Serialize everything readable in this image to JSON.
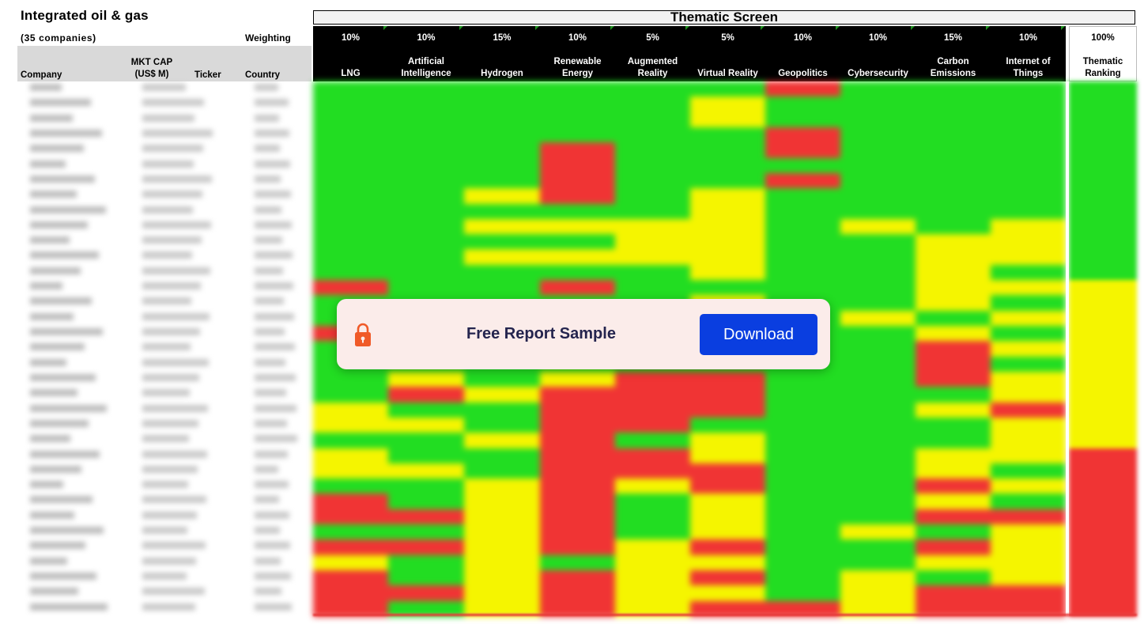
{
  "sheet": {
    "title": "Integrated oil & gas",
    "subtitle": "(35 companies)",
    "weighting_label": "Weighting",
    "thematic_screen_label": "Thematic Screen"
  },
  "columns": {
    "company": "Company",
    "mkt_cap_line1": "MKT CAP",
    "mkt_cap_line2": "(US$ M)",
    "ticker": "Ticker",
    "country": "Country"
  },
  "themes": [
    {
      "weight": "10%",
      "name_line1": "",
      "name_line2": "LNG"
    },
    {
      "weight": "10%",
      "name_line1": "Artificial",
      "name_line2": "Intelligence"
    },
    {
      "weight": "15%",
      "name_line1": "",
      "name_line2": "Hydrogen"
    },
    {
      "weight": "10%",
      "name_line1": "Renewable",
      "name_line2": "Energy"
    },
    {
      "weight": "5%",
      "name_line1": "Augmented",
      "name_line2": "Reality"
    },
    {
      "weight": "5%",
      "name_line1": "",
      "name_line2": "Virtual Reality"
    },
    {
      "weight": "10%",
      "name_line1": "",
      "name_line2": "Geopolitics"
    },
    {
      "weight": "10%",
      "name_line1": "",
      "name_line2": "Cybersecurity"
    },
    {
      "weight": "15%",
      "name_line1": "Carbon",
      "name_line2": "Emissions"
    },
    {
      "weight": "10%",
      "name_line1": "Internet of",
      "name_line2": "Things"
    }
  ],
  "ranking": {
    "weight": "100%",
    "name_line1": "Thematic",
    "name_line2": "Ranking"
  },
  "colors": {
    "green": "#22dd22",
    "yellow": "#f5f500",
    "red": "#f03434"
  },
  "score_grid": [
    "GGGGGGRGGG",
    "GGGGGYGGGG",
    "GGGGGYGGGG",
    "GGGGGGRGGG",
    "GGGRGGRGGG",
    "GGGRGGGGGG",
    "GGGRGGRGGG",
    "GGYRGYGGGG",
    "GGGGGYGGGG",
    "GGYYYYGYGY",
    "GGGGYYGGYY",
    "GGYYYYGGYY",
    "GGGGGYGGYG",
    "RGGRGGGGYY",
    "GGGGGYGGYG",
    "GRYYGGGYGY",
    "RGGGGGGGYG",
    "GGGRGGGGRY",
    "GGGGGGGGRG",
    "GYGYRRGGRY",
    "GRYRRRGGGY",
    "YGGRRRGGYR",
    "YYGRRGGGGY",
    "GGYRGYGGGY",
    "YGGRRYGGYY",
    "YYGRRRGGYG",
    "GGYRYRGGRY",
    "RGYRGYGGYG",
    "RRYRGYGGRR",
    "GGYRGYGYGY",
    "RRYRYRGGRY",
    "YGYGYYGGYY",
    "RGYRYRGYGY",
    "RRYRYYGYRR",
    "RGYRYRRYRR"
  ],
  "ranking_grid": "GGGGGGGGGGGGGYYYYYYYYYYYRRRRRRRRRRR",
  "banner": {
    "text": "Free Report Sample",
    "button_label": "Download",
    "lock_icon": "padlock-icon"
  }
}
